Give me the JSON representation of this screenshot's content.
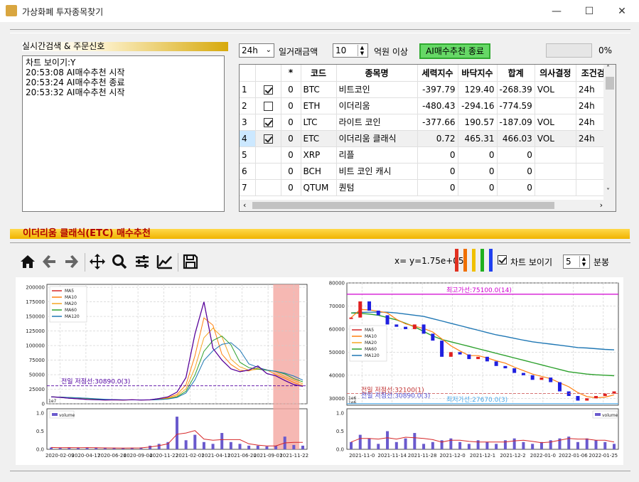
{
  "window": {
    "title": "가상화폐 투자종목찾기",
    "minimize": "—",
    "maximize": "☐",
    "close": "✕"
  },
  "left_panel": {
    "header": "실시간검색 & 주문신호",
    "log_lines": [
      "차트 보이기:Y",
      "20:53:08 AI매수추천 시작",
      "20:53:24 AI매수추천 종료",
      "20:53:32 AI매수추천 시작"
    ]
  },
  "filters": {
    "period": "24h",
    "volume_label": "일거래금액",
    "volume_value": "10",
    "unit_label": "억원 이상",
    "ai_button": "AI매수추천 종료",
    "progress_text": "0%",
    "progress_value": 0
  },
  "grid": {
    "columns": [
      "",
      "",
      "*",
      "코드",
      "종목명",
      "세력지수",
      "바닥지수",
      "합계",
      "의사결정",
      "조건검"
    ],
    "rows": [
      {
        "n": "1",
        "chk": "on",
        "star": "0",
        "code": "BTC",
        "name": "비트코인",
        "force": "-397.79",
        "floor": "129.40",
        "sum": "-268.39",
        "dec": "VOL",
        "cond": "24h"
      },
      {
        "n": "2",
        "chk": "off",
        "star": "0",
        "code": "ETH",
        "name": "이더리움",
        "force": "-480.43",
        "floor": "-294.16",
        "sum": "-774.59",
        "dec": "",
        "cond": "24h"
      },
      {
        "n": "3",
        "chk": "on",
        "star": "0",
        "code": "LTC",
        "name": "라이트 코인",
        "force": "-377.66",
        "floor": "190.57",
        "sum": "-187.09",
        "dec": "VOL",
        "cond": "24h"
      },
      {
        "n": "4",
        "chk": "on",
        "star": "0",
        "code": "ETC",
        "name": "이더리움 클래식",
        "force": "0.72",
        "floor": "465.31",
        "sum": "466.03",
        "dec": "VOL",
        "cond": "24h"
      },
      {
        "n": "5",
        "chk": "",
        "star": "0",
        "code": "XRP",
        "name": "리플",
        "force": "0",
        "floor": "0",
        "sum": "0",
        "dec": "",
        "cond": ""
      },
      {
        "n": "6",
        "chk": "",
        "star": "0",
        "code": "BCH",
        "name": "비트 코인 캐시",
        "force": "0",
        "floor": "0",
        "sum": "0",
        "dec": "",
        "cond": ""
      },
      {
        "n": "7",
        "chk": "",
        "star": "0",
        "code": "QTUM",
        "name": "퀀텀",
        "force": "0",
        "floor": "0",
        "sum": "0",
        "dec": "",
        "cond": ""
      }
    ]
  },
  "selection": {
    "header": "이더리움 클래식(ETC) 매수추천"
  },
  "toolbar": {
    "coords": "x= y=1.75e+05",
    "color_bars": [
      "#e03020",
      "#f07000",
      "#f0c000",
      "#20b020",
      "#2040f0"
    ],
    "show_chart": "차트 보이기",
    "minutes_value": "5",
    "minutes_label": "분봉"
  },
  "chart_data": [
    {
      "type": "line",
      "legend": [
        "MA5",
        "MA10",
        "MA20",
        "MA60",
        "MA120"
      ],
      "colors": [
        "#d62728",
        "#ff7f0e",
        "#f5a623",
        "#2ca02c",
        "#1f77b4"
      ],
      "yticks": [
        "200000",
        "175000",
        "150000",
        "125000",
        "100000",
        "75000",
        "50000",
        "25000",
        "0"
      ],
      "ylim": [
        0,
        205000
      ],
      "scale_note": "1e7",
      "xticks": [
        "2020-02-09",
        "2020-04-17",
        "2020-06-26",
        "2020-09-04",
        "2020-11-22",
        "2021-02-01",
        "2021-04-11",
        "2021-06-20",
        "2021-09-01",
        "2021-11-22"
      ],
      "annotation": "전일 저점선:30890.0(3)",
      "annotation_value": 30890,
      "close": [
        12000,
        11000,
        9500,
        8500,
        7500,
        7000,
        6500,
        6800,
        6500,
        7000,
        6500,
        6800,
        9000,
        12000,
        20000,
        45000,
        120000,
        175000,
        95000,
        75000,
        60000,
        55000,
        58000,
        65000,
        52000,
        48000,
        40000,
        33000,
        30000
      ],
      "ma_offsets": [
        0,
        3000,
        6000,
        9000,
        12000
      ],
      "shade": [
        0.87,
        0.97
      ],
      "volume_legend": "volume",
      "volume_yticks": [
        "1.0",
        "0.5",
        "0.0"
      ],
      "volume": [
        0.05,
        0.04,
        0.05,
        0.04,
        0.05,
        0.04,
        0.03,
        0.04,
        0.03,
        0.04,
        0.05,
        0.1,
        0.15,
        0.2,
        0.9,
        0.25,
        0.4,
        0.2,
        0.15,
        0.45,
        0.2,
        0.15,
        0.1,
        0.1,
        0.08,
        0.1,
        0.35,
        0.12,
        0.1
      ]
    },
    {
      "type": "line",
      "legend": [
        "MA5",
        "MA10",
        "MA20",
        "MA60",
        "MA120"
      ],
      "colors": [
        "#d62728",
        "#ff7f0e",
        "#f5a623",
        "#2ca02c",
        "#1f77b4"
      ],
      "yticks": [
        "80000",
        "70000",
        "60000",
        "50000",
        "40000",
        "30000"
      ],
      "ylim": [
        27000,
        80000
      ],
      "scale_note": "1e6",
      "xticks": [
        "2021-11-0",
        "2021-11-14",
        "2021-11-28",
        "2021-12-0",
        "2021-12-1",
        "2021-12-2",
        "2022-01-0",
        "2022-01-06",
        "2022-01-25"
      ],
      "max_line": "최고가선:75100.0(14)",
      "max_value": 75100,
      "min_line": "최저가선:27670.0(3)",
      "min_value": 27670,
      "prev_high": "전일 저점선:32100(1)",
      "prev_low": "전일 저점선:30890.0(3)",
      "close": [
        65000,
        72000,
        68000,
        66000,
        62000,
        61000,
        60000,
        62000,
        58000,
        55000,
        48000,
        50000,
        49000,
        47000,
        48000,
        46000,
        44000,
        43000,
        41000,
        40000,
        38000,
        39000,
        37000,
        33000,
        31000,
        29000,
        30000,
        31000,
        32000,
        33000
      ],
      "ma60": [
        67000,
        66800,
        66500,
        66000,
        65000,
        64000,
        62500,
        61000,
        59000,
        57000,
        55500,
        54500,
        53500,
        52500,
        51500,
        50500,
        49500,
        48500,
        47500,
        46500,
        45500,
        44500,
        43500,
        42500,
        41500,
        41000,
        40500,
        40200,
        40000,
        39800
      ],
      "ma120": [
        67000,
        67200,
        67300,
        67400,
        67300,
        67000,
        66500,
        66000,
        65500,
        64500,
        63500,
        62500,
        61500,
        60500,
        59500,
        58500,
        57500,
        56800,
        56000,
        55200,
        54500,
        54000,
        53500,
        53000,
        52500,
        52000,
        51800,
        51500,
        51200,
        51000
      ],
      "volume_legend": "volume",
      "volume_yticks": [
        "1.0",
        "0.5",
        "0.0"
      ],
      "volume": [
        0.2,
        0.4,
        0.3,
        0.15,
        0.5,
        0.2,
        0.3,
        0.45,
        0.15,
        0.2,
        0.25,
        0.3,
        0.2,
        0.15,
        0.25,
        0.2,
        0.15,
        0.25,
        0.3,
        0.2,
        0.15,
        0.2,
        0.25,
        0.3,
        0.35,
        0.2,
        0.3,
        0.25,
        0.2,
        0.15
      ]
    }
  ]
}
